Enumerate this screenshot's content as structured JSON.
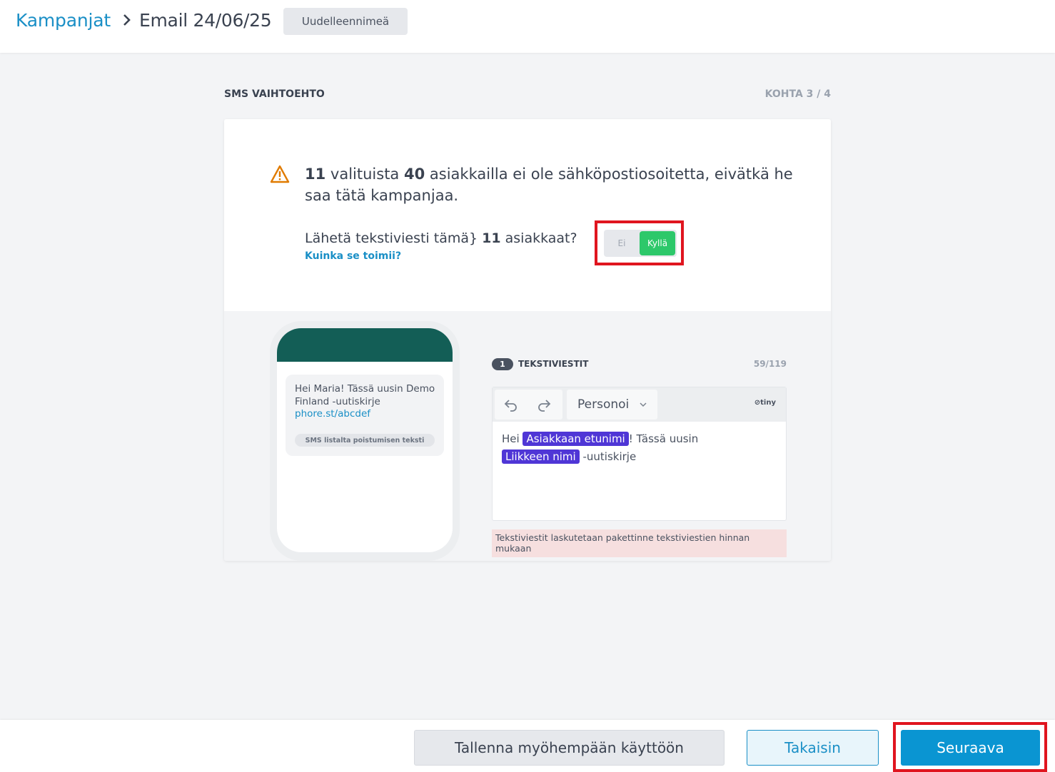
{
  "header": {
    "breadcrumb_root": "Kampanjat",
    "breadcrumb_current": "Email 24/06/25",
    "rename_label": "Uudelleennimeä"
  },
  "step": {
    "title": "SMS VAIHTOEHTO",
    "counter": "KOHTA 3 / 4"
  },
  "warning": {
    "missing_count": "11",
    "text_1": " valituista ",
    "selected_count": "40",
    "text_2": " asiakkailla ei ole sähköpostiosoitetta, eivätkä he saa tätä kampanjaa."
  },
  "question": {
    "text_before": "Lähetä tekstiviesti tämä} ",
    "count": "11",
    "text_after": " asiakkaat?",
    "howto_link": "Kuinka se toimii?"
  },
  "toggle": {
    "no_label": "Ei",
    "yes_label": "Kyllä",
    "selected": "Kyllä"
  },
  "phone_preview": {
    "message": "Hei Maria! Tässä uusin Demo Finland -uutiskirje",
    "link": "phore.st/abcdef",
    "unsubscribe_tag": "SMS listalta poistumisen teksti"
  },
  "sms_editor": {
    "badge": "1",
    "label": "TEKSTIVIESTIT",
    "char_count": "59/119",
    "personalize_label": "Personoi",
    "editor_brand": "tiny",
    "body": {
      "prefix": "Hei ",
      "chip_first_name": "Asiakkaan etunimi",
      "middle": "! Tässä uusin",
      "chip_business": "Liikkeen nimi",
      "suffix": " -uutiskirje"
    },
    "billing_note": "Tekstiviestit laskutetaan pakettinne tekstiviestien hinnan mukaan"
  },
  "footer": {
    "save_label": "Tallenna myöhempään käyttöön",
    "back_label": "Takaisin",
    "next_label": "Seuraava"
  },
  "colors": {
    "accent": "#1a8fc6",
    "primary_button": "#0a95d2",
    "toggle_on": "#2dc86a",
    "highlight_border": "#e0151f",
    "phone_header": "#135e56",
    "chip": "#4f36d6",
    "warning_icon": "#e07b00"
  }
}
